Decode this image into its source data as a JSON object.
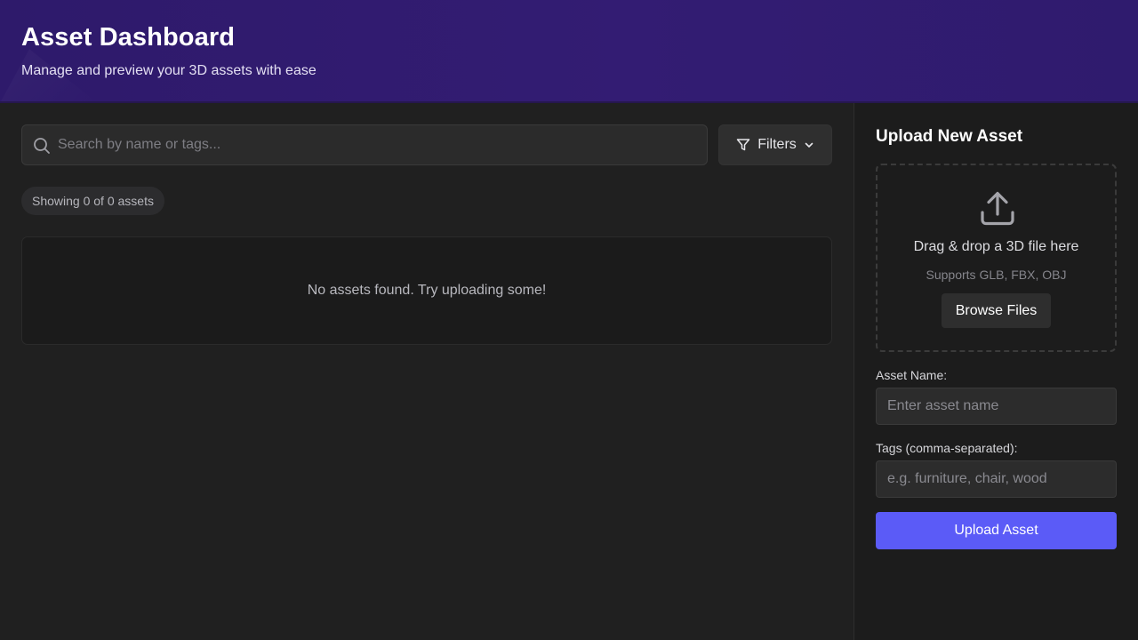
{
  "header": {
    "title": "Asset Dashboard",
    "subtitle": "Manage and preview your 3D assets with ease"
  },
  "search": {
    "placeholder": "Search by name or tags...",
    "value": "",
    "icon": "search-icon"
  },
  "filters": {
    "label": "Filters",
    "icon": "filter-icon",
    "chevron": "chevron-down-icon"
  },
  "assets": {
    "count_text": "Showing 0 of 0 assets",
    "empty_message": "No assets found. Try uploading some!"
  },
  "upload": {
    "title": "Upload New Asset",
    "dropzone_text": "Drag & drop a 3D file here",
    "dropzone_subtext": "Supports GLB, FBX, OBJ",
    "browse_label": "Browse Files",
    "icon": "upload-icon",
    "name_label": "Asset Name:",
    "name_placeholder": "Enter asset name",
    "name_value": "",
    "tags_label": "Tags (comma-separated):",
    "tags_placeholder": "e.g. furniture, chair, wood",
    "tags_value": "",
    "submit_label": "Upload Asset"
  },
  "colors": {
    "header_gradient": "#331c73",
    "accent": "#5b5bf7",
    "background": "#202020",
    "sidebar_background": "#1c1c1c"
  }
}
